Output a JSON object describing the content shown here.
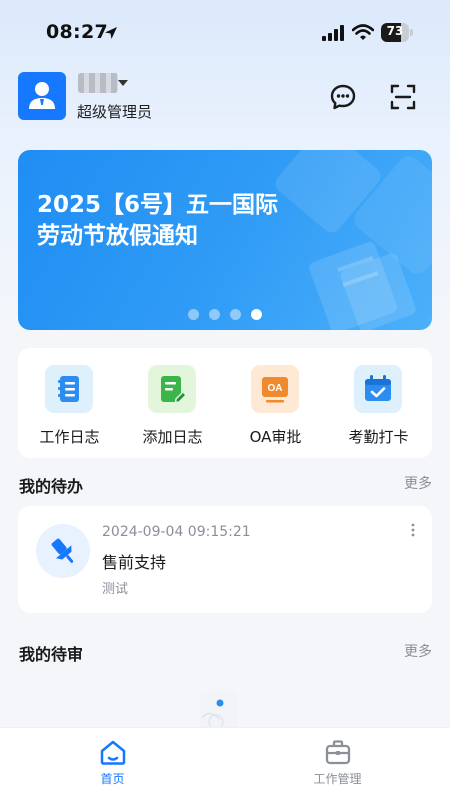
{
  "status_bar": {
    "time": "08:27",
    "battery": "73",
    "battery_level": 0.73
  },
  "header": {
    "user_name": "██",
    "role": "超级管理员"
  },
  "banner": {
    "title": "2025【6号】五一国际劳动节放假通知",
    "slide_count": 4,
    "active_slide": 4
  },
  "quick_actions": [
    {
      "label": "工作日志",
      "icon": "notebook-icon",
      "color": "#dff0fd"
    },
    {
      "label": "添加日志",
      "icon": "add-log-icon",
      "color": "#e3f6dc"
    },
    {
      "label": "OA审批",
      "icon": "oa-approval-icon",
      "color": "#fde9d4"
    },
    {
      "label": "考勤打卡",
      "icon": "calendar-check-icon",
      "color": "#dff0fd"
    }
  ],
  "todo_section": {
    "title": "我的待办",
    "more": "更多"
  },
  "todo_items": [
    {
      "time": "2024-09-04 09:15:21",
      "title": "售前支持",
      "subtitle": "测试"
    }
  ],
  "review_section": {
    "title": "我的待审",
    "more": "更多"
  },
  "bottom_nav": [
    {
      "label": "首页",
      "icon": "home-icon",
      "active": true
    },
    {
      "label": "工作管理",
      "icon": "briefcase-icon",
      "active": false
    }
  ],
  "colors": {
    "accent": "#1677ff",
    "muted": "#8a8f99"
  }
}
